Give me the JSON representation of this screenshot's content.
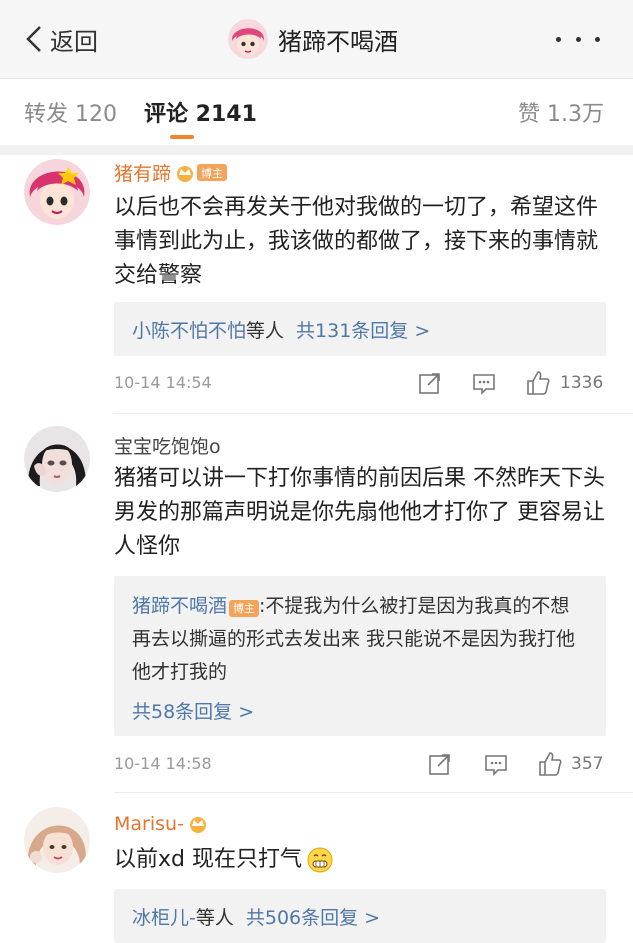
{
  "nav": {
    "back_label": "返回",
    "title": "猪蹄不喝酒",
    "more_icon": "more-icon"
  },
  "tabs": {
    "repost": "转发 120",
    "comment": "评论 2141",
    "like": "赞 1.3万",
    "active_color": "#f1852b"
  },
  "comments": [
    {
      "username": "猪有蹄",
      "badge": "博主",
      "text": "以后也不会再发关于他对我做的一切了，希望这件事情到此为止，我该做的都做了，接下来的事情就交给警察",
      "reply_names": "小陈不怕不怕",
      "reply_mid": "等人",
      "reply_count": "共131条回复 >",
      "time": "10-14 14:54",
      "likes": "1336"
    },
    {
      "username": "宝宝吃饱饱o",
      "text": "猪猪可以讲一下打你事情的前因后果 不然昨天下头男发的那篇声明说是你先扇他他才打你了 更容易让人怪你",
      "reply_author": "猪蹄不喝酒",
      "reply_badge": "博主",
      "reply_text": ":不提我为什么被打是因为我真的不想再去以撕逼的形式去发出来 我只能说不是因为我打他他才打我的",
      "reply_count": "共58条回复 >",
      "time": "10-14 14:58",
      "likes": "357"
    },
    {
      "username": "Marisu-",
      "text": "以前xd 现在只打气",
      "reply_names": "冰柜儿-",
      "reply_mid": "等人",
      "reply_count": "共506条回复 >"
    }
  ],
  "colors": {
    "username_orange": "#e8742e",
    "link_blue": "#4f78a8",
    "bozhu_badge": "#f3a35a"
  }
}
